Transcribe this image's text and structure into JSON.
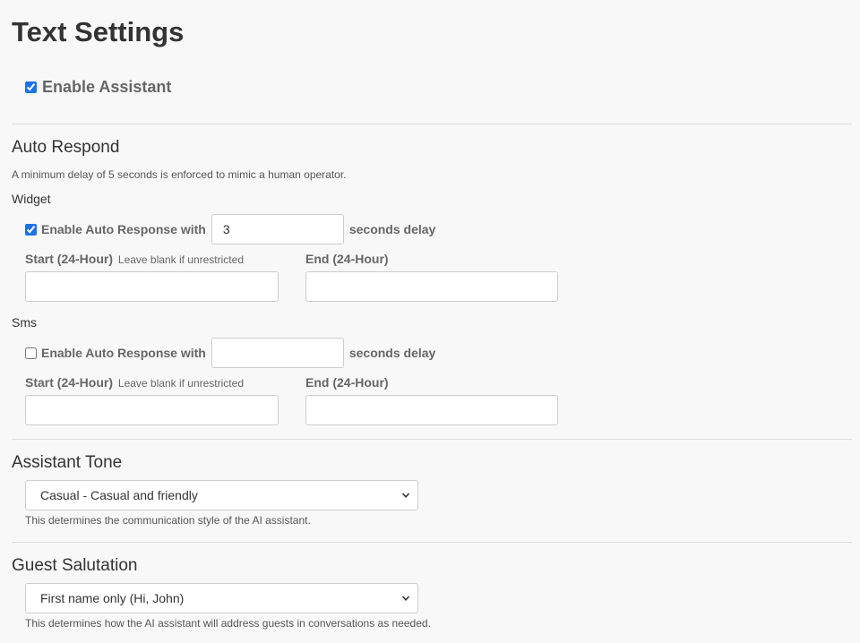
{
  "page": {
    "title": "Text Settings"
  },
  "assistant": {
    "enable_label": "Enable Assistant",
    "enabled": true
  },
  "auto_respond": {
    "title": "Auto Respond",
    "help": "A minimum delay of 5 seconds is enforced to mimic a human operator.",
    "channels": [
      {
        "name": "Widget",
        "enabled": true,
        "enable_label": "Enable Auto Response with",
        "delay_value": "3",
        "delay_suffix": "seconds delay",
        "start_label": "Start (24-Hour)",
        "start_hint": "Leave blank if unrestricted",
        "start_value": "",
        "end_label": "End (24-Hour)",
        "end_value": ""
      },
      {
        "name": "Sms",
        "enabled": false,
        "enable_label": "Enable Auto Response with",
        "delay_value": "",
        "delay_suffix": "seconds delay",
        "start_label": "Start (24-Hour)",
        "start_hint": "Leave blank if unrestricted",
        "start_value": "",
        "end_label": "End (24-Hour)",
        "end_value": ""
      }
    ]
  },
  "tone": {
    "title": "Assistant Tone",
    "selected": "Casual - Casual and friendly",
    "help": "This determines the communication style of the AI assistant."
  },
  "salutation": {
    "title": "Guest Salutation",
    "selected": "First name only (Hi, John)",
    "help": "This determines how the AI assistant will address guests in conversations as needed."
  },
  "colors": {
    "accent": "#1a73e8",
    "background": "#f8f8f8",
    "divider": "#dddddd"
  }
}
